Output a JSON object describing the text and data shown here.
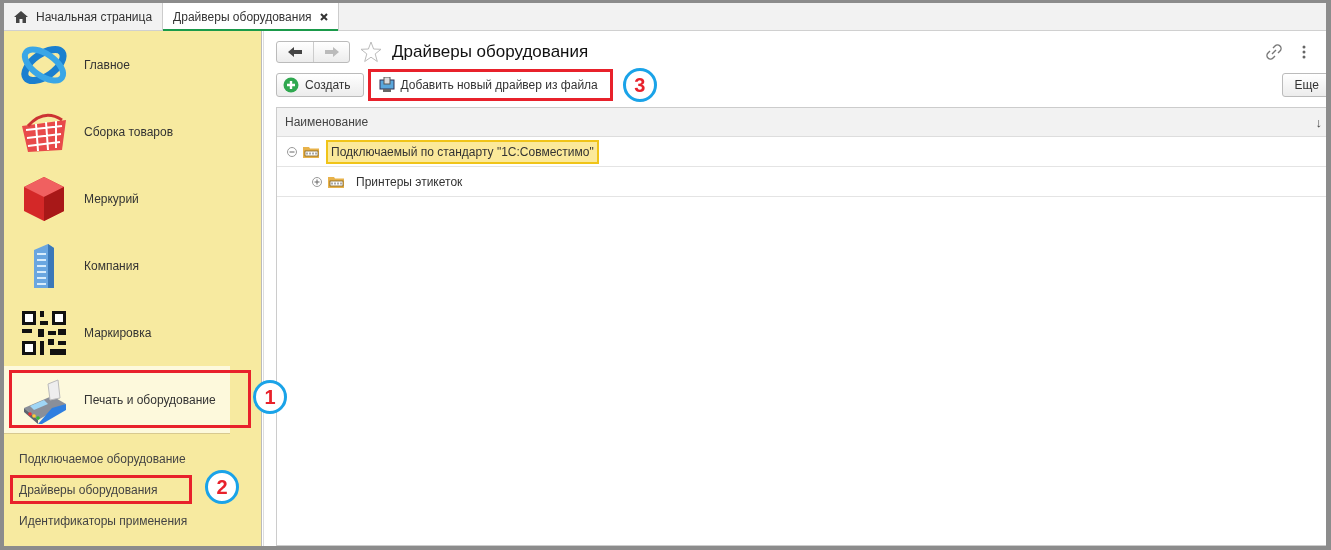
{
  "tabs": [
    {
      "label": "Начальная страница",
      "kind": "home",
      "selected": false
    },
    {
      "label": "Драйверы оборудования",
      "kind": "page",
      "selected": true,
      "closable": true
    }
  ],
  "sidebar": {
    "sections": [
      {
        "label": "Главное",
        "kind": "orbit",
        "selected": false
      },
      {
        "label": "Сборка товаров",
        "kind": "basket",
        "selected": false
      },
      {
        "label": "Меркурий",
        "kind": "cube",
        "selected": false
      },
      {
        "label": "Компания",
        "kind": "building",
        "selected": false
      },
      {
        "label": "Маркировка",
        "kind": "qr",
        "selected": false
      },
      {
        "label": "Печать и оборудование",
        "kind": "terminal",
        "selected": true,
        "callout": "1"
      }
    ],
    "links": [
      {
        "label": "Подключаемое оборудование"
      },
      {
        "label": "Драйверы оборудования",
        "callout": "2"
      },
      {
        "label": "Идентификаторы применения"
      }
    ]
  },
  "window": {
    "title": "Драйверы оборудования",
    "favorite": false,
    "back_disabled": false,
    "forward_disabled": true
  },
  "toolbar": {
    "buttons": [
      {
        "label": "Создать",
        "kind": "create"
      },
      {
        "label": "Добавить новый драйвер из файла",
        "kind": "add-file",
        "callout": "3"
      }
    ],
    "more": "Еще"
  },
  "table": {
    "columns": [
      {
        "label": "Наименование",
        "sort": "↓"
      }
    ],
    "rows": [
      {
        "label": "Подключаемый по стандарту \"1С:Совместимо\"",
        "selected": true,
        "expanded": true,
        "children": [
          {
            "label": "Принтеры этикеток",
            "selected": false,
            "expanded": false
          }
        ]
      }
    ]
  }
}
